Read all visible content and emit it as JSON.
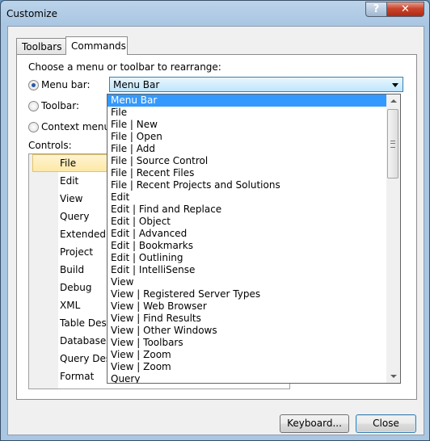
{
  "window": {
    "title": "Customize",
    "help_symbol": "?",
    "close_symbol": "✕"
  },
  "tabs": [
    {
      "label": "Toolbars",
      "active": false
    },
    {
      "label": "Commands",
      "active": true
    }
  ],
  "rearrange": {
    "prompt": "Choose a menu or toolbar to rearrange:",
    "options": [
      {
        "label": "Menu bar:",
        "checked": true
      },
      {
        "label": "Toolbar:",
        "checked": false
      },
      {
        "label": "Context menu:",
        "checked": false
      }
    ],
    "menu_bar_value": "Menu Bar"
  },
  "controls": {
    "label": "Controls:",
    "items": [
      "File",
      "Edit",
      "View",
      "Query",
      "Extended Ev",
      "Project",
      "Build",
      "Debug",
      "XML",
      "Table Desig",
      "Database Di",
      "Query Desig",
      "Format"
    ]
  },
  "dropdown": {
    "items": [
      "Menu Bar",
      "File",
      "File | New",
      "File | Open",
      "File | Add",
      "File | Source Control",
      "File | Recent Files",
      "File | Recent Projects and Solutions",
      "Edit",
      "Edit | Find and Replace",
      "Edit | Object",
      "Edit | Advanced",
      "Edit | Bookmarks",
      "Edit | Outlining",
      "Edit | IntelliSense",
      "View",
      "View | Registered Server Types",
      "View | Web Browser",
      "View | Find Results",
      "View | Other Windows",
      "View | Toolbars",
      "View | Zoom",
      "View | Zoom",
      "Query"
    ],
    "selected_index": 0
  },
  "buttons": {
    "keyboard": "Keyboard...",
    "close": "Close"
  },
  "colors": {
    "selection": "#3399ff",
    "title_close": "#c8452c"
  }
}
